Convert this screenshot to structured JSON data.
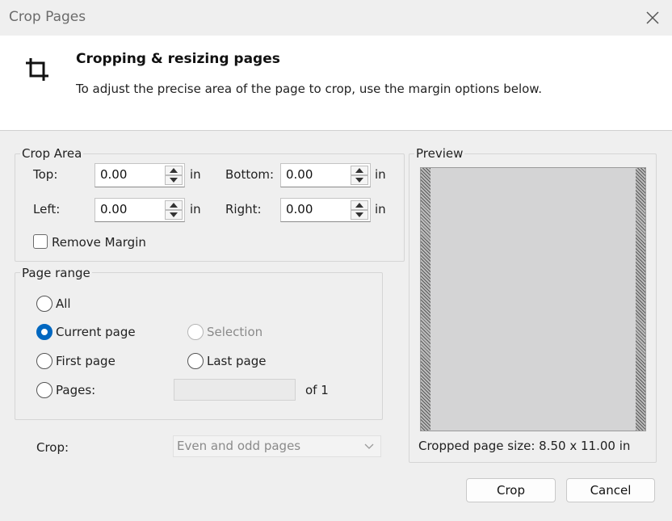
{
  "window": {
    "title": "Crop Pages"
  },
  "header": {
    "title": "Cropping & resizing pages",
    "description": "To adjust the precise area of the page to crop, use the margin options below."
  },
  "crop_area": {
    "legend": "Crop Area",
    "top": {
      "label": "Top:",
      "value": "0.00",
      "unit": "in"
    },
    "bottom": {
      "label": "Bottom:",
      "value": "0.00",
      "unit": "in"
    },
    "left": {
      "label": "Left:",
      "value": "0.00",
      "unit": "in"
    },
    "right": {
      "label": "Right:",
      "value": "0.00",
      "unit": "in"
    },
    "remove_margin_label": "Remove Margin",
    "remove_margin_checked": false
  },
  "page_range": {
    "legend": "Page range",
    "all_label": "All",
    "current_label": "Current page",
    "selection_label": "Selection",
    "first_label": "First page",
    "last_label": "Last page",
    "pages_label": "Pages:",
    "pages_value": "",
    "of_label": "of 1",
    "selected": "current"
  },
  "crop_filter": {
    "label": "Crop:",
    "value": "Even and odd pages"
  },
  "preview": {
    "legend": "Preview",
    "size_text": "Cropped page size: 8.50 x 11.00 in"
  },
  "buttons": {
    "crop": "Crop",
    "cancel": "Cancel"
  },
  "colors": {
    "accent": "#0067c0"
  }
}
